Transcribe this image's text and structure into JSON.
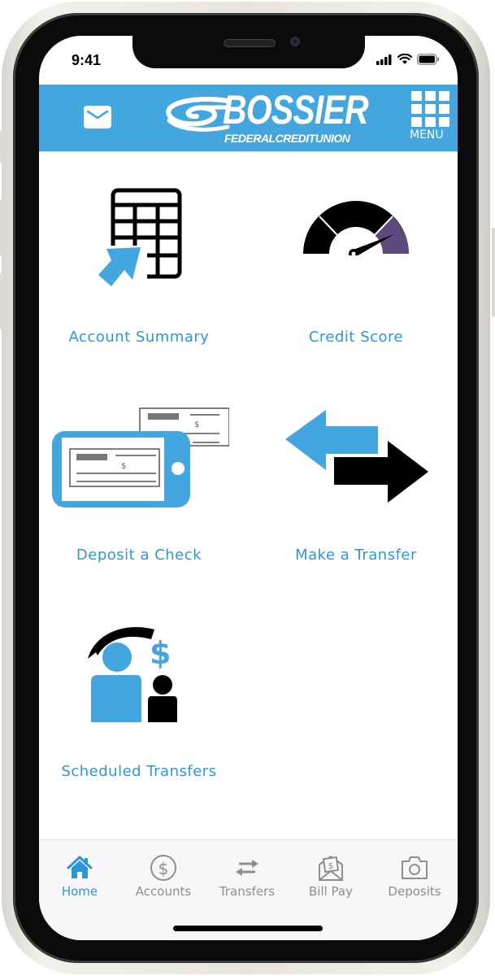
{
  "status_bar": {
    "time": "9:41",
    "icons": [
      "signal-icon",
      "wifi-icon",
      "battery-icon"
    ]
  },
  "header": {
    "brand_name": "BOSSIER",
    "brand_subtitle": "FEDERALCREDITUNION",
    "mail_icon": "mail-icon",
    "menu_label": "MENU",
    "background_color": "#44a6de"
  },
  "tiles": [
    {
      "label": "Account Summary",
      "icon": "spreadsheet-arrow-icon"
    },
    {
      "label": "Credit Score",
      "icon": "gauge-icon"
    },
    {
      "label": "Deposit a Check",
      "icon": "phone-check-icon"
    },
    {
      "label": "Make a Transfer",
      "icon": "transfer-arrows-icon"
    },
    {
      "label": "Scheduled Transfers",
      "icon": "people-dollar-icon"
    }
  ],
  "tabbar": {
    "items": [
      {
        "label": "Home",
        "icon": "home-icon",
        "active": true
      },
      {
        "label": "Accounts",
        "icon": "dollar-circle-icon",
        "active": false
      },
      {
        "label": "Transfers",
        "icon": "transfer-icon",
        "active": false
      },
      {
        "label": "Bill Pay",
        "icon": "bill-envelope-icon",
        "active": false
      },
      {
        "label": "Deposits",
        "icon": "camera-icon",
        "active": false
      }
    ],
    "active_color": "#2c97d6",
    "inactive_color": "#8e8e8e"
  },
  "colors": {
    "accent": "#44a6de",
    "label_blue": "#2c97d6",
    "gauge_purple": "#5e4a7e"
  }
}
